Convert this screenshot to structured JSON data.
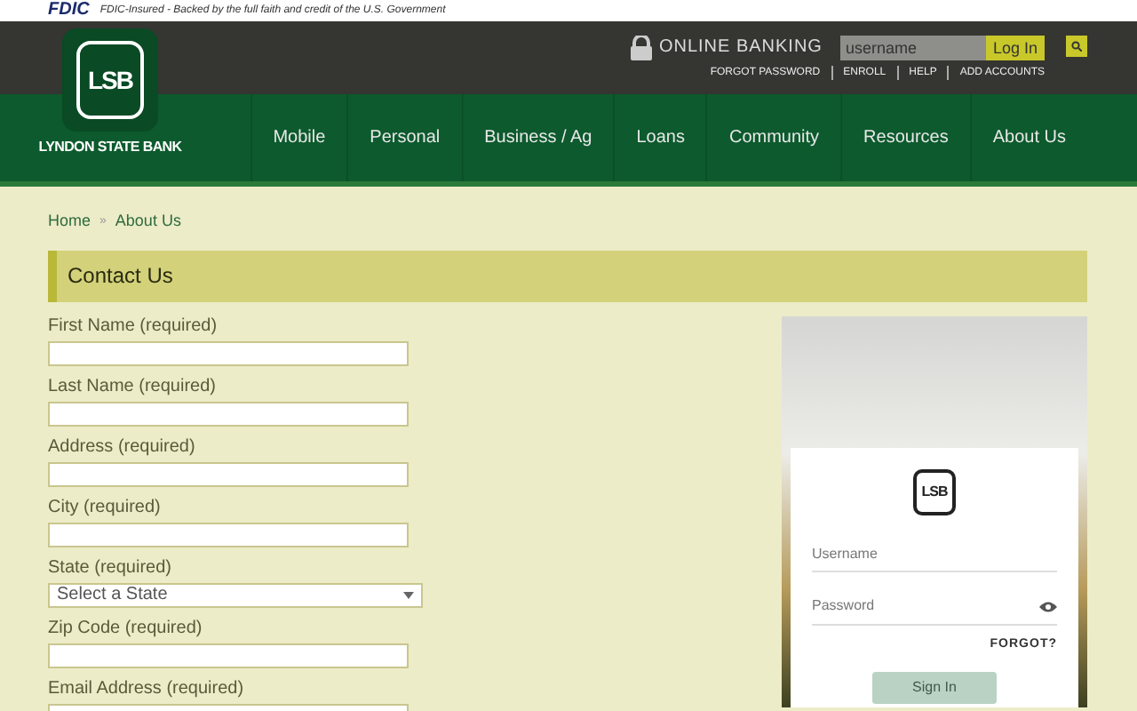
{
  "top_bar": {
    "fdic_logo": "FDIC",
    "notice": "FDIC-Insured - Backed by the full faith and credit of the U.S. Government"
  },
  "header": {
    "logo": {
      "mark": "LSB",
      "name": "LYNDON STATE BANK"
    },
    "online_banking": {
      "title": "ONLINE BANKING",
      "username_placeholder": "username",
      "login_button": "Log In",
      "links": [
        "FORGOT PASSWORD",
        "ENROLL",
        "HELP",
        "ADD ACCOUNTS"
      ]
    },
    "nav": [
      "Mobile",
      "Personal",
      "Business / Ag",
      "Loans",
      "Community",
      "Resources",
      "About Us"
    ]
  },
  "breadcrumb": [
    "Home",
    "About Us"
  ],
  "breadcrumb_separator": "»",
  "page_title": "Contact Us",
  "form": [
    {
      "kind": "text",
      "label": "First Name (required)"
    },
    {
      "kind": "text",
      "label": "Last Name (required)"
    },
    {
      "kind": "text",
      "label": "Address (required)"
    },
    {
      "kind": "text",
      "label": "City (required)"
    },
    {
      "kind": "select",
      "label": "State (required)",
      "value": "Select a State"
    },
    {
      "kind": "text",
      "label": "Zip Code (required)"
    },
    {
      "kind": "text",
      "label": "Email Address (required)"
    }
  ],
  "login_card": {
    "logo": "LSB",
    "username_placeholder": "Username",
    "password_placeholder": "Password",
    "forgot": "FORGOT?",
    "sign_in": "Sign In"
  }
}
